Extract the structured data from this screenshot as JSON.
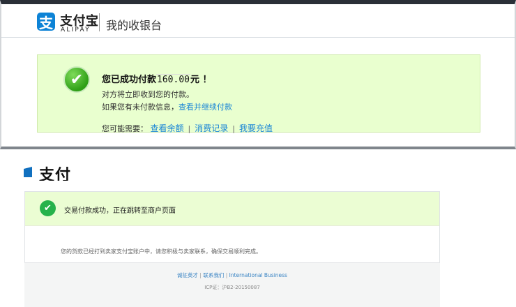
{
  "top": {
    "logo": {
      "glyph": "支",
      "brand_cn": "支付宝",
      "brand_en": "ALIPAY"
    },
    "header_title": "我的收银台",
    "success": {
      "prefix": "您已成功付款",
      "amount": "160.00",
      "unit": "元 ！",
      "receive_text": "对方将立即收到您的付款。",
      "continue_prefix": "如果您有未付款信息，",
      "continue_link": "查看并继续付款",
      "maybe_label": "您可能需要：",
      "links": [
        "查看余额",
        "消费记录",
        "我要充值"
      ],
      "separator": "|"
    }
  },
  "bottom": {
    "logo_partial": "支付",
    "redirect_title": "交易付款成功，正在跳转至商户页面",
    "redirect_desc": "您的货款已经打到卖家支付宝账户中，请您积极与卖家联系，确保交易顺利完成。",
    "footer": {
      "links": [
        "诚征英才",
        "联系我们",
        "International Business"
      ],
      "separator": "|",
      "icp": "ICP证：沪B2-20150087"
    }
  },
  "colors": {
    "link": "#1a86d6",
    "success_bg": "#e9ffcf",
    "brand_blue": "#0d83d6",
    "check_green": "#26b24b"
  },
  "icons": [
    "alipay-logo-icon",
    "success-check-icon",
    "small-check-icon"
  ]
}
